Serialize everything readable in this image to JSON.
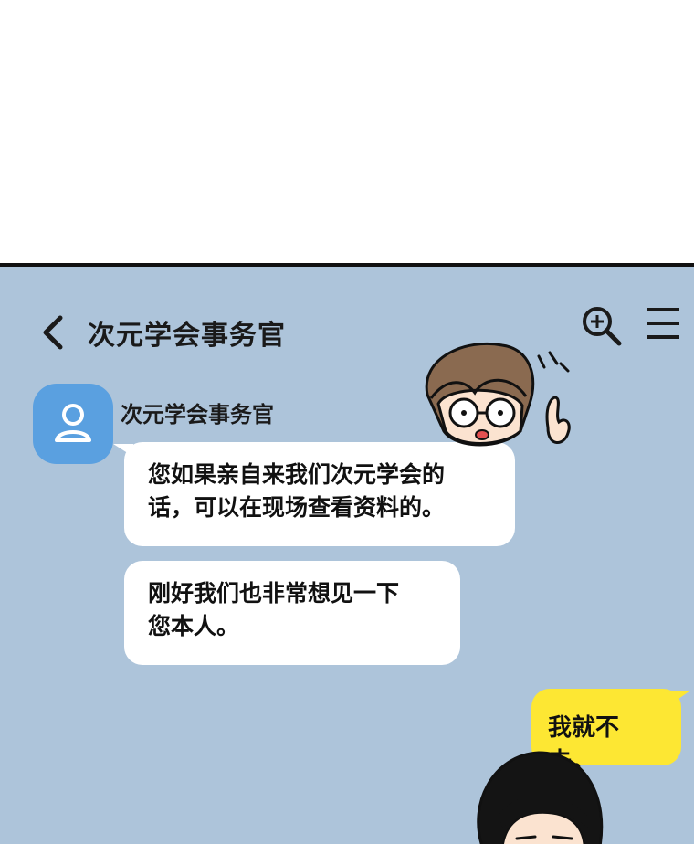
{
  "header": {
    "title": "次元学会事务官",
    "back_icon": "chevron-left-icon",
    "search_icon": "zoom-in-icon",
    "menu_icon": "menu-icon"
  },
  "colors": {
    "chat_background": "#adc4da",
    "avatar": "#5aa0e0",
    "incoming_bubble": "#ffffff",
    "outgoing_bubble": "#fde733"
  },
  "messages": [
    {
      "sender": "次元学会事务官",
      "lines": [
        "您如果亲自来我们次元学会的",
        "话，可以在现场查看资料的。"
      ]
    },
    {
      "lines": [
        "刚好我们也非常想见一下",
        "您本人。"
      ]
    }
  ],
  "my_message": {
    "text": "我就不去。"
  }
}
